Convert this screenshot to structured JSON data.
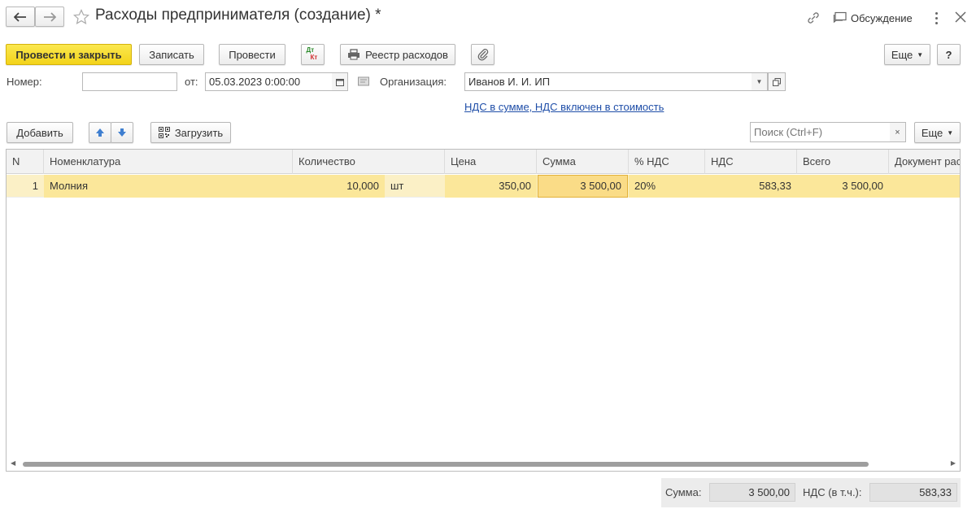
{
  "window": {
    "title": "Расходы предпринимателя (создание) *",
    "discussion_label": "Обсуждение"
  },
  "toolbar": {
    "post_close_label": "Провести и закрыть",
    "save_label": "Записать",
    "post_label": "Провести",
    "dt_label": "Дт",
    "kt_label": "Кт",
    "register_label": "Реестр расходов",
    "more_label": "Еще",
    "help_label": "?"
  },
  "form": {
    "number_label": "Номер:",
    "number_value": "",
    "date_label": "от:",
    "date_value": "05.03.2023  0:00:00",
    "org_label": "Организация:",
    "org_value": "Иванов И. И. ИП",
    "vat_link": "НДС в сумме, НДС включен в стоимость"
  },
  "table_toolbar": {
    "add_label": "Добавить",
    "load_label": "Загрузить",
    "search_placeholder": "Поиск (Ctrl+F)",
    "more_label": "Еще"
  },
  "table": {
    "headers": [
      "N",
      "Номенклатура",
      "Количество",
      "Цена",
      "Сумма",
      "% НДС",
      "НДС",
      "Всего",
      "Документ рас"
    ],
    "rows": [
      {
        "n": "1",
        "item": "Молния",
        "qty": "10,000",
        "unit": "шт",
        "price": "350,00",
        "sum": "3 500,00",
        "vat_rate": "20%",
        "vat": "583,33",
        "total": "3 500,00",
        "doc": ""
      }
    ]
  },
  "footer": {
    "sum_label": "Сумма:",
    "sum_value": "3 500,00",
    "vat_label": "НДС (в т.ч.):",
    "vat_value": "583,33"
  },
  "colors": {
    "primary_button": "#f5d51e",
    "selected_row": "#fbf0c6",
    "link": "#1f4ea8"
  }
}
